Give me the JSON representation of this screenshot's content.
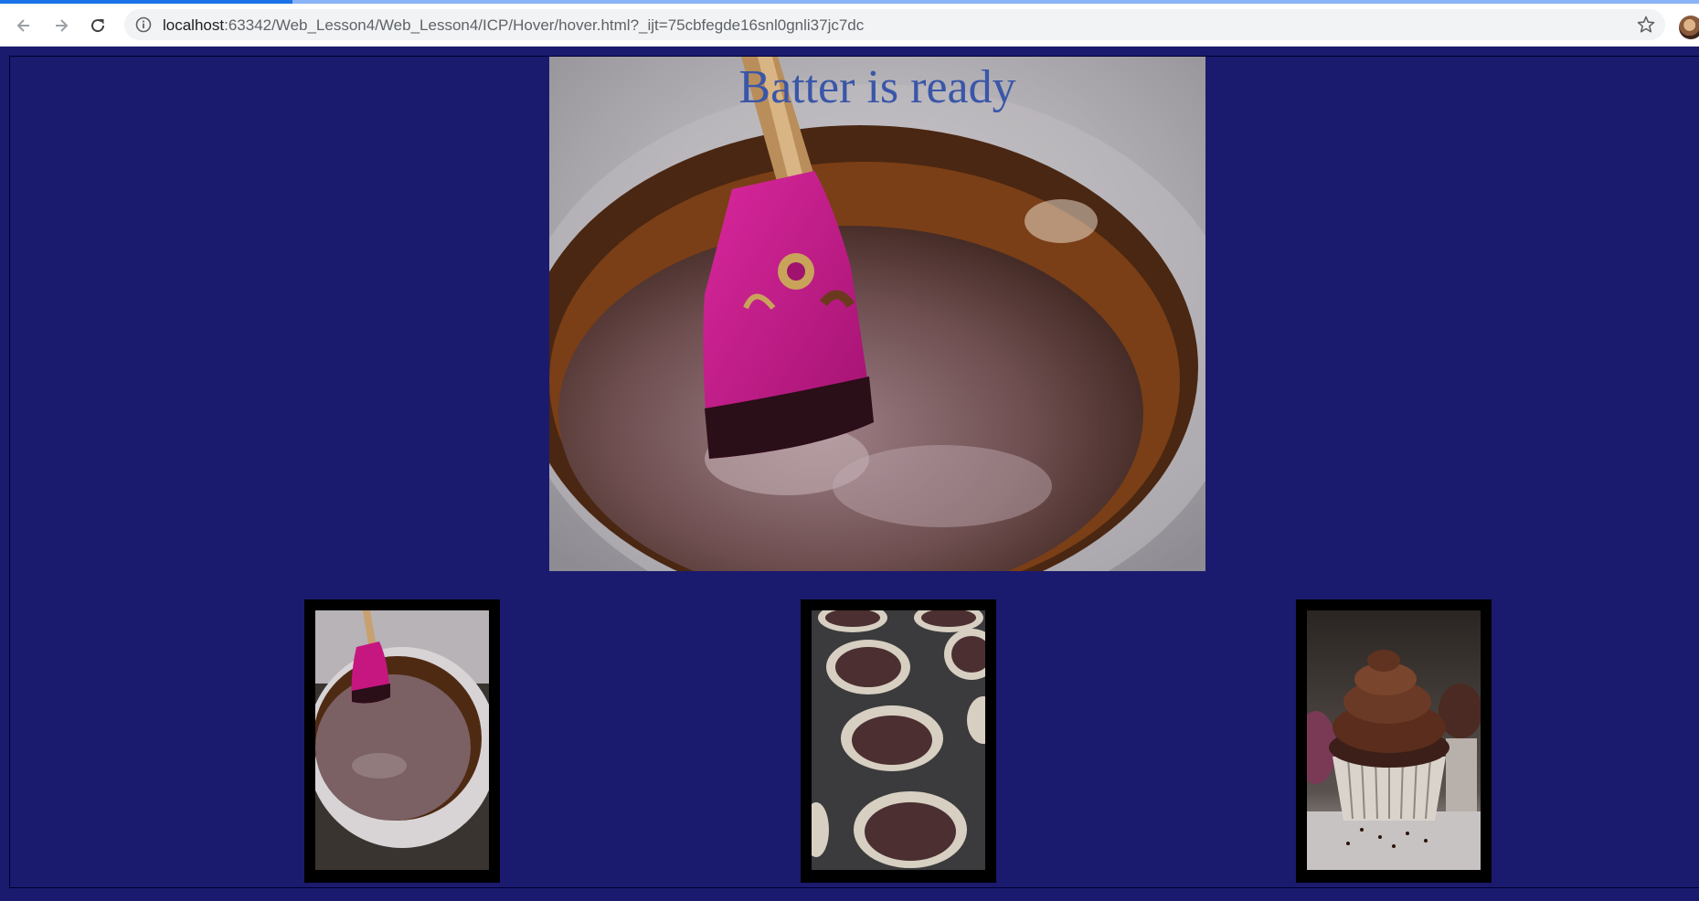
{
  "browser": {
    "url_host": "localhost",
    "url_rest": ":63342/Web_Lesson4/Web_Lesson4/ICP/Hover/hover.html?_ijt=75cbfegde16snl0gnli37jc7dc",
    "icons": [
      "back-arrow-icon",
      "forward-arrow-icon",
      "reload-icon",
      "info-icon",
      "bookmark-star-icon",
      "profile-avatar"
    ]
  },
  "page": {
    "background": "#1a1a6e",
    "hero_caption": "Batter is ready",
    "hero_caption_color": "#3a56a8",
    "thumbnails": [
      {
        "subject": "batter with pink spatula"
      },
      {
        "subject": "muffin tin with batter"
      },
      {
        "subject": "frosted chocolate cupcake"
      }
    ]
  }
}
